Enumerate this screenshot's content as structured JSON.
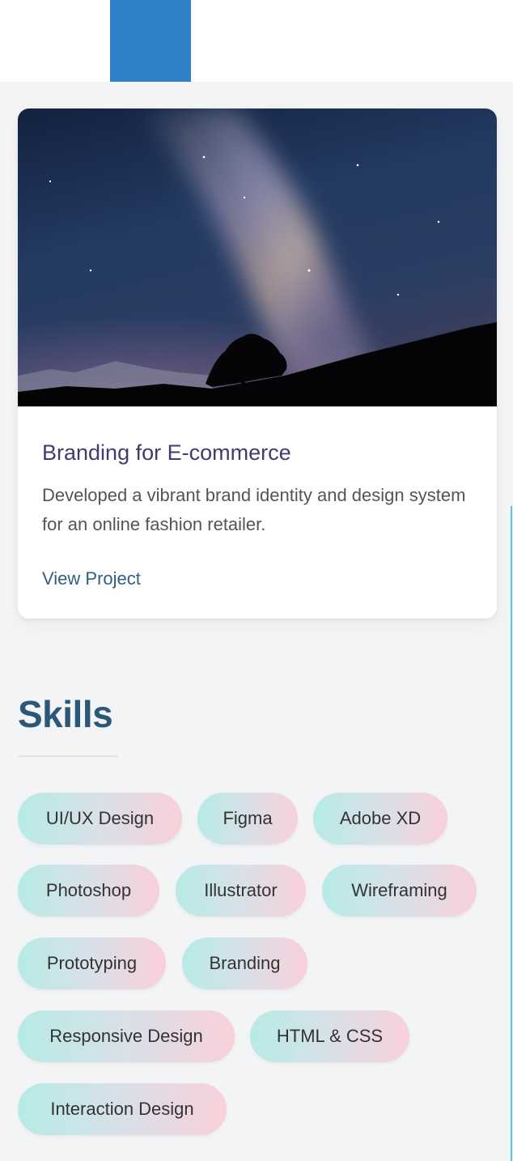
{
  "project": {
    "title": "Branding for E-commerce",
    "description": "Developed a vibrant brand identity and design system for an online fashion retailer.",
    "link_label": "View Project"
  },
  "skills": {
    "title": "Skills",
    "items": [
      "UI/UX Design",
      "Figma",
      "Adobe XD",
      "Photoshop",
      "Illustrator",
      "Wireframing",
      "Prototyping",
      "Branding",
      "Responsive Design",
      "HTML & CSS",
      "Interaction Design"
    ]
  },
  "colors": {
    "accent_blue": "#2f80c7",
    "title_text": "#3e3d6e",
    "link_text": "#2f5f82",
    "skills_heading": "#2c5877",
    "chip_gradient_start": "#b6ebe6",
    "chip_gradient_end": "#f9d0da",
    "page_background": "#f3f4f6"
  }
}
